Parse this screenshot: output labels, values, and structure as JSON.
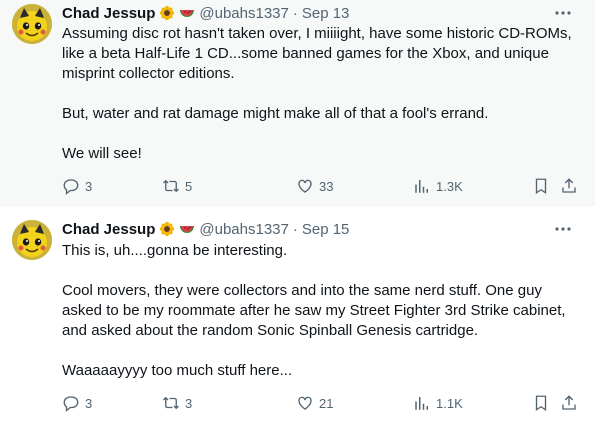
{
  "tweets": [
    {
      "author": {
        "name": "Chad Jessup",
        "handle": "@ubahs1337"
      },
      "date": "Sep 13",
      "separator": "·",
      "paragraphs": [
        "Assuming disc rot hasn't taken over, I miiiight, have some historic CD-ROMs, like a beta Half-Life 1 CD...some banned games for the Xbox, and unique misprint collector editions.",
        "But, water and rat damage might make all of that a fool's errand.",
        "We will see!"
      ],
      "replies": "3",
      "retweets": "5",
      "likes": "33",
      "views": "1.3K"
    },
    {
      "author": {
        "name": "Chad Jessup",
        "handle": "@ubahs1337"
      },
      "date": "Sep 15",
      "separator": "·",
      "paragraphs": [
        "This is, uh....gonna be interesting.",
        "Cool movers, they were collectors and into the same nerd stuff. One guy asked to be my roommate after he saw my Street Fighter 3rd Strike cabinet, and asked about the random Sonic Spinball Genesis cartridge.",
        "Waaaaayyyy too much stuff here..."
      ],
      "replies": "3",
      "retweets": "3",
      "likes": "21",
      "views": "1.1K"
    }
  ],
  "icons": {
    "name_emojis": [
      "sunflower-icon",
      "watermelon-icon"
    ],
    "more": "more-icon",
    "actions": [
      "reply-icon",
      "retweet-icon",
      "like-icon",
      "views-icon",
      "bookmark-icon",
      "share-icon"
    ]
  },
  "colors": {
    "text": "#0f1419",
    "secondary": "#536471",
    "first_bg": "#f7f9f9"
  }
}
